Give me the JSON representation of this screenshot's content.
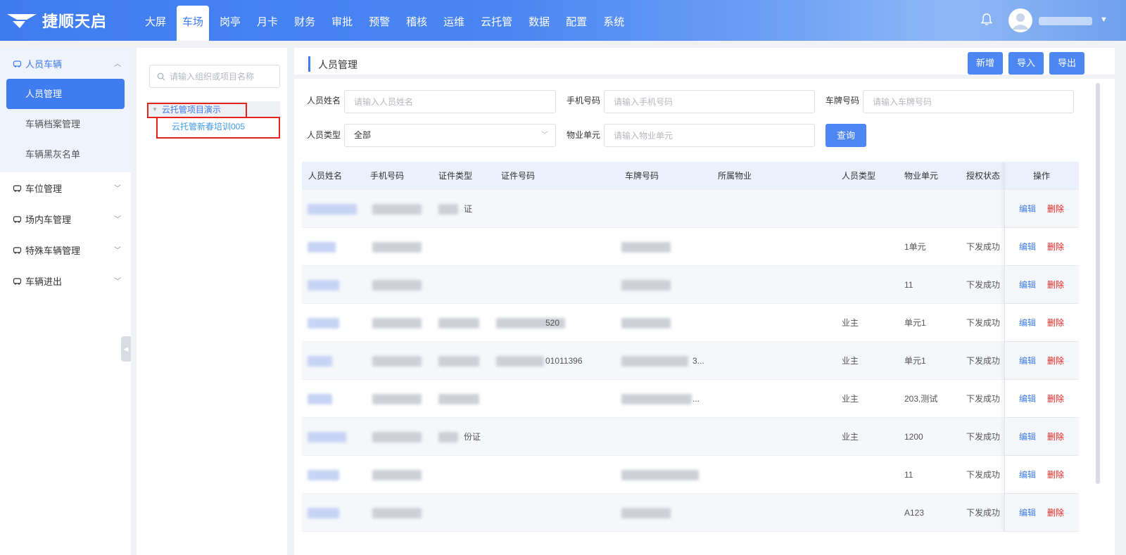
{
  "brand": {
    "name": "捷顺天启"
  },
  "nav": [
    "大屏",
    "车场",
    "岗亭",
    "月卡",
    "财务",
    "审批",
    "预警",
    "稽核",
    "运维",
    "云托管",
    "数据",
    "配置",
    "系统"
  ],
  "nav_active": "车场",
  "sidebar": {
    "groups": [
      {
        "label": "人员车辆",
        "icon": "car-people-icon",
        "open": true,
        "items": [
          "人员管理",
          "车辆档案管理",
          "车辆黑灰名单"
        ],
        "active_item": "人员管理"
      },
      {
        "label": "车位管理",
        "icon": "parking-space-icon"
      },
      {
        "label": "场内车管理",
        "icon": "indoor-car-icon"
      },
      {
        "label": "特殊车辆管理",
        "icon": "special-car-icon"
      },
      {
        "label": "车辆进出",
        "icon": "car-inout-icon"
      }
    ]
  },
  "tree": {
    "search_placeholder": "请输入组织或项目名称",
    "root": "云托管项目演示",
    "child": "云托管新春培训005"
  },
  "main": {
    "title": "人员管理",
    "buttons": {
      "add": "新增",
      "import": "导入",
      "export": "导出"
    }
  },
  "filters": {
    "name_label": "人员姓名",
    "name_placeholder": "请输入人员姓名",
    "phone_label": "手机号码",
    "phone_placeholder": "请输入手机号码",
    "plate_label": "车牌号码",
    "plate_placeholder": "请输入车牌号码",
    "type_label": "人员类型",
    "type_value": "全部",
    "unit_label": "物业单元",
    "unit_placeholder": "请输入物业单元",
    "query": "查询"
  },
  "table": {
    "columns": [
      "人员姓名",
      "手机号码",
      "证件类型",
      "证件号码",
      "车牌号码",
      "所属物业",
      "人员类型",
      "物业单元",
      "授权状态",
      "操作"
    ],
    "edit_label": "编辑",
    "delete_label": "删除",
    "rows": [
      {
        "id_type": "证",
        "id_no": "",
        "plate": "",
        "person_type": "",
        "unit": "",
        "status": ""
      },
      {
        "id_type": "",
        "id_no": "",
        "plate": "",
        "person_type": "",
        "unit": "1单元",
        "status": "下发成功"
      },
      {
        "id_type": "",
        "id_no": "",
        "plate": "",
        "person_type": "",
        "unit": "11",
        "status": "下发成功"
      },
      {
        "id_type": "",
        "id_no": "520",
        "plate": "",
        "person_type": "业主",
        "unit": "单元1",
        "status": "下发成功"
      },
      {
        "id_type": "",
        "id_no": "01011396",
        "plate": "3...",
        "person_type": "业主",
        "unit": "单元1",
        "status": "下发成功"
      },
      {
        "id_type": "",
        "id_no": "",
        "plate": "...",
        "person_type": "业主",
        "unit": "203,测试",
        "status": "下发成功"
      },
      {
        "id_type": "份证",
        "id_no": "",
        "plate": "",
        "person_type": "业主",
        "unit": "1200",
        "status": "下发成功"
      },
      {
        "id_type": "",
        "id_no": "",
        "plate": "",
        "person_type": "",
        "unit": "11",
        "status": "下发成功"
      },
      {
        "id_type": "",
        "id_no": "",
        "plate": "",
        "person_type": "",
        "unit": "A123",
        "status": "下发成功"
      }
    ]
  }
}
